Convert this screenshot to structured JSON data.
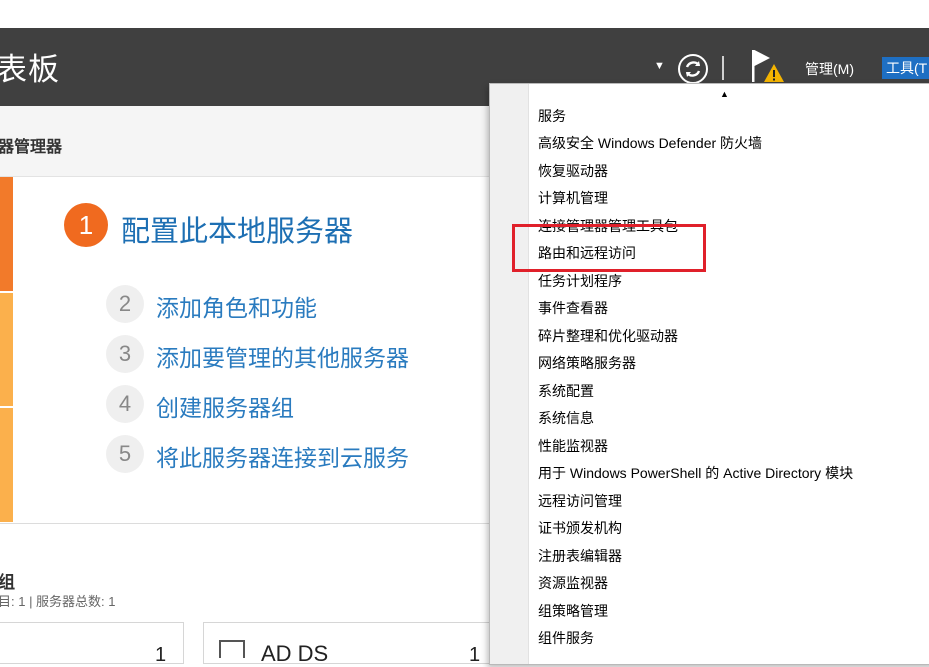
{
  "header": {
    "title": "表板",
    "manage_label": "管理(M)",
    "tools_label": "工具(T"
  },
  "subheader": {
    "label": "器管理器"
  },
  "welcome": {
    "step1": {
      "number": "1",
      "label": "配置此本地服务器"
    },
    "steps": [
      {
        "number": "2",
        "label": "添加角色和功能"
      },
      {
        "number": "3",
        "label": "添加要管理的其他服务器"
      },
      {
        "number": "4",
        "label": "创建服务器组"
      },
      {
        "number": "5",
        "label": "将此服务器连接到云服务"
      }
    ]
  },
  "groups": {
    "title": "组",
    "summary": "目: 1 | 服务器总数: 1"
  },
  "tiles": [
    {
      "count": "1",
      "label": ""
    },
    {
      "count": "1",
      "label": "AD DS"
    }
  ],
  "tools_menu": {
    "items": [
      "服务",
      "高级安全 Windows Defender 防火墙",
      "恢复驱动器",
      "计算机管理",
      "连接管理器管理工具包",
      "路由和远程访问",
      "任务计划程序",
      "事件查看器",
      "碎片整理和优化驱动器",
      "网络策略服务器",
      "系统配置",
      "系统信息",
      "性能监视器",
      "用于 Windows PowerShell 的 Active Directory 模块",
      "远程访问管理",
      "证书颁发机构",
      "注册表编辑器",
      "资源监视器",
      "组策略管理",
      "组件服务"
    ],
    "highlighted_item": "路由和远程访问"
  },
  "colors": {
    "topbar": "#404040",
    "accent_blue": "#1e6fc3",
    "step1_orange": "#f06a1f",
    "highlight_red": "#e0202a"
  }
}
